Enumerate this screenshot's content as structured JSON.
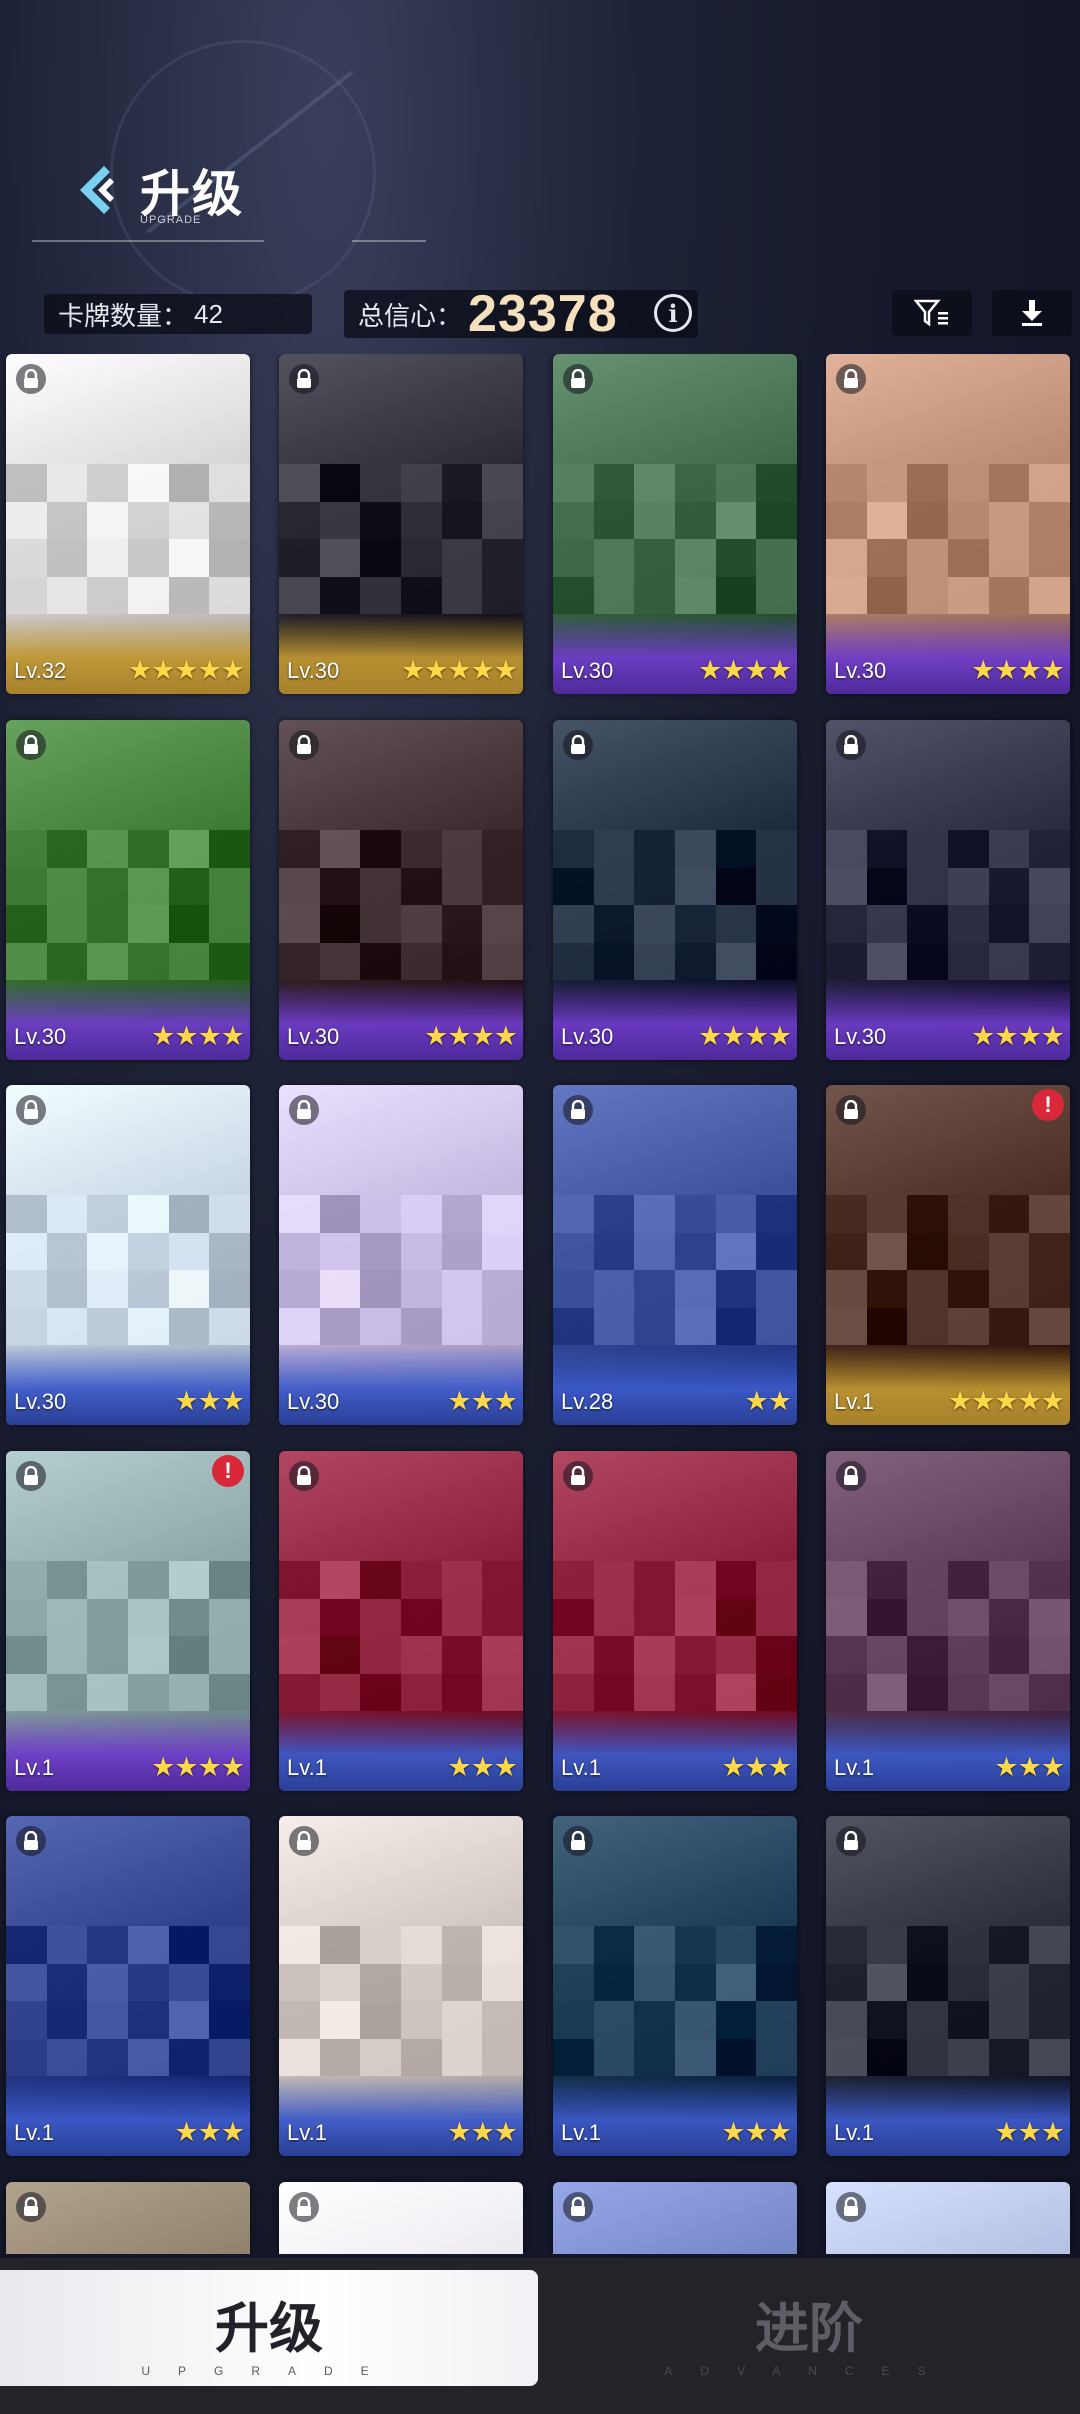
{
  "header": {
    "title": "升级",
    "subtitle": "UPGRADE"
  },
  "stats": {
    "card_count_label": "卡牌数量：",
    "card_count": "42",
    "trust_label": "总信心：",
    "trust_value": "23378"
  },
  "cards": [
    {
      "level": "Lv.32",
      "stars": "★★★★★",
      "rarity": "gold",
      "theme": "#d9d6d8",
      "alert": false
    },
    {
      "level": "Lv.30",
      "stars": "★★★★★",
      "rarity": "gold",
      "theme": "#2b2a35",
      "alert": false
    },
    {
      "level": "Lv.30",
      "stars": "★★★★",
      "rarity": "purple",
      "theme": "#3f6a4a",
      "alert": false
    },
    {
      "level": "Lv.30",
      "stars": "★★★★",
      "rarity": "purple",
      "theme": "#b98a72",
      "alert": false
    },
    {
      "level": "Lv.30",
      "stars": "★★★★",
      "rarity": "purple",
      "theme": "#3f7a35",
      "alert": false
    },
    {
      "level": "Lv.30",
      "stars": "★★★★",
      "rarity": "purple",
      "theme": "#3a2a2e",
      "alert": false
    },
    {
      "level": "Lv.30",
      "stars": "★★★★",
      "rarity": "purple",
      "theme": "#1e2a3e",
      "alert": false
    },
    {
      "level": "Lv.30",
      "stars": "★★★★",
      "rarity": "purple",
      "theme": "#2a2a40",
      "alert": false
    },
    {
      "level": "Lv.30",
      "stars": "★★★",
      "rarity": "blue",
      "theme": "#c9d6e6",
      "alert": false
    },
    {
      "level": "Lv.30",
      "stars": "★★★",
      "rarity": "blue",
      "theme": "#c4b8e0",
      "alert": false
    },
    {
      "level": "Lv.28",
      "stars": "★★",
      "rarity": "blue",
      "theme": "#3c4f9a",
      "alert": false
    },
    {
      "level": "Lv.1",
      "stars": "★★★★★",
      "rarity": "gold",
      "theme": "#4a2e24",
      "alert": true
    },
    {
      "level": "Lv.1",
      "stars": "★★★★",
      "rarity": "purple",
      "theme": "#8da6a8",
      "alert": true
    },
    {
      "level": "Lv.1",
      "stars": "★★★",
      "rarity": "blue",
      "theme": "#8a1f3a",
      "alert": false
    },
    {
      "level": "Lv.1",
      "stars": "★★★",
      "rarity": "blue",
      "theme": "#8a1f3a",
      "alert": false
    },
    {
      "level": "Lv.1",
      "stars": "★★★",
      "rarity": "blue",
      "theme": "#5a3a55",
      "alert": false
    },
    {
      "level": "Lv.1",
      "stars": "★★★",
      "rarity": "blue",
      "theme": "#2e3f8a",
      "alert": false
    },
    {
      "level": "Lv.1",
      "stars": "★★★",
      "rarity": "blue",
      "theme": "#cfc6c2",
      "alert": false
    },
    {
      "level": "Lv.1",
      "stars": "★★★",
      "rarity": "blue",
      "theme": "#1b3a55",
      "alert": false
    },
    {
      "level": "Lv.1",
      "stars": "★★★",
      "rarity": "blue",
      "theme": "#2a2d3a",
      "alert": false
    },
    {
      "level": "",
      "stars": "",
      "rarity": "blue",
      "theme": "#8a7a66",
      "alert": false
    },
    {
      "level": "",
      "stars": "",
      "rarity": "blue",
      "theme": "#e8e6ee",
      "alert": false
    },
    {
      "level": "",
      "stars": "",
      "rarity": "blue",
      "theme": "#6e7fc0",
      "alert": false
    },
    {
      "level": "",
      "stars": "",
      "rarity": "blue",
      "theme": "#aeb9dc",
      "alert": false
    }
  ],
  "tabs": [
    {
      "label": "升级",
      "sub": "UPGRADE",
      "active": true
    },
    {
      "label": "进阶",
      "sub": "ADVANCES",
      "active": false
    }
  ],
  "colors": {
    "gold_footer": "#b8963a",
    "purple_footer": "#6b3fc8",
    "blue_footer": "#3a5bc8",
    "trust_value": "#f7e0bd",
    "star": "#ffd84a",
    "alert": "#d8283a"
  }
}
